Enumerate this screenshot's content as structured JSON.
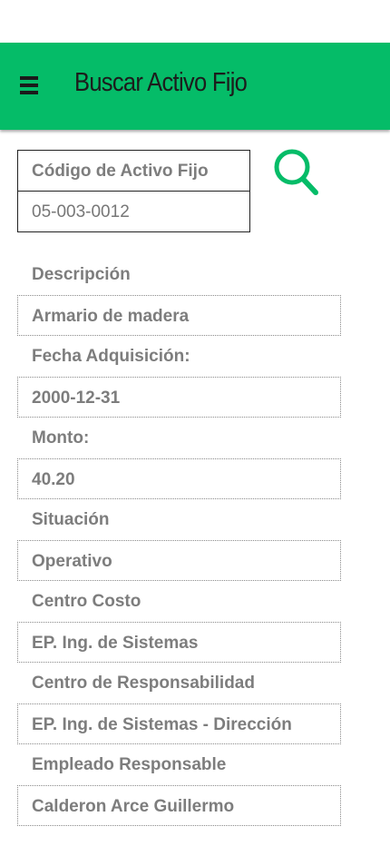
{
  "header": {
    "title": "Buscar Activo Fijo",
    "menu_icon": "hamburger-menu-icon",
    "background_color": "#05bc68"
  },
  "search": {
    "code_label": "Código de Activo Fijo",
    "code_value": "05-003-0012",
    "search_icon": "magnifier-icon",
    "accent_color": "#05bc68"
  },
  "fields": {
    "descripcion": {
      "label": "Descripción",
      "value": "Armario de madera"
    },
    "fecha_adquisicion": {
      "label": "Fecha Adquisición:",
      "value": "2000-12-31"
    },
    "monto": {
      "label": "Monto:",
      "value": "40.20"
    },
    "situacion": {
      "label": "Situación",
      "value": "Operativo"
    },
    "centro_costo": {
      "label": "Centro Costo",
      "value": "EP. Ing. de Sistemas"
    },
    "centro_responsabilidad": {
      "label": "Centro de Responsabilidad",
      "value": "EP. Ing. de Sistemas - Dirección"
    },
    "empleado_responsable": {
      "label": "Empleado Responsable",
      "value": "Calderon Arce Guillermo"
    }
  }
}
